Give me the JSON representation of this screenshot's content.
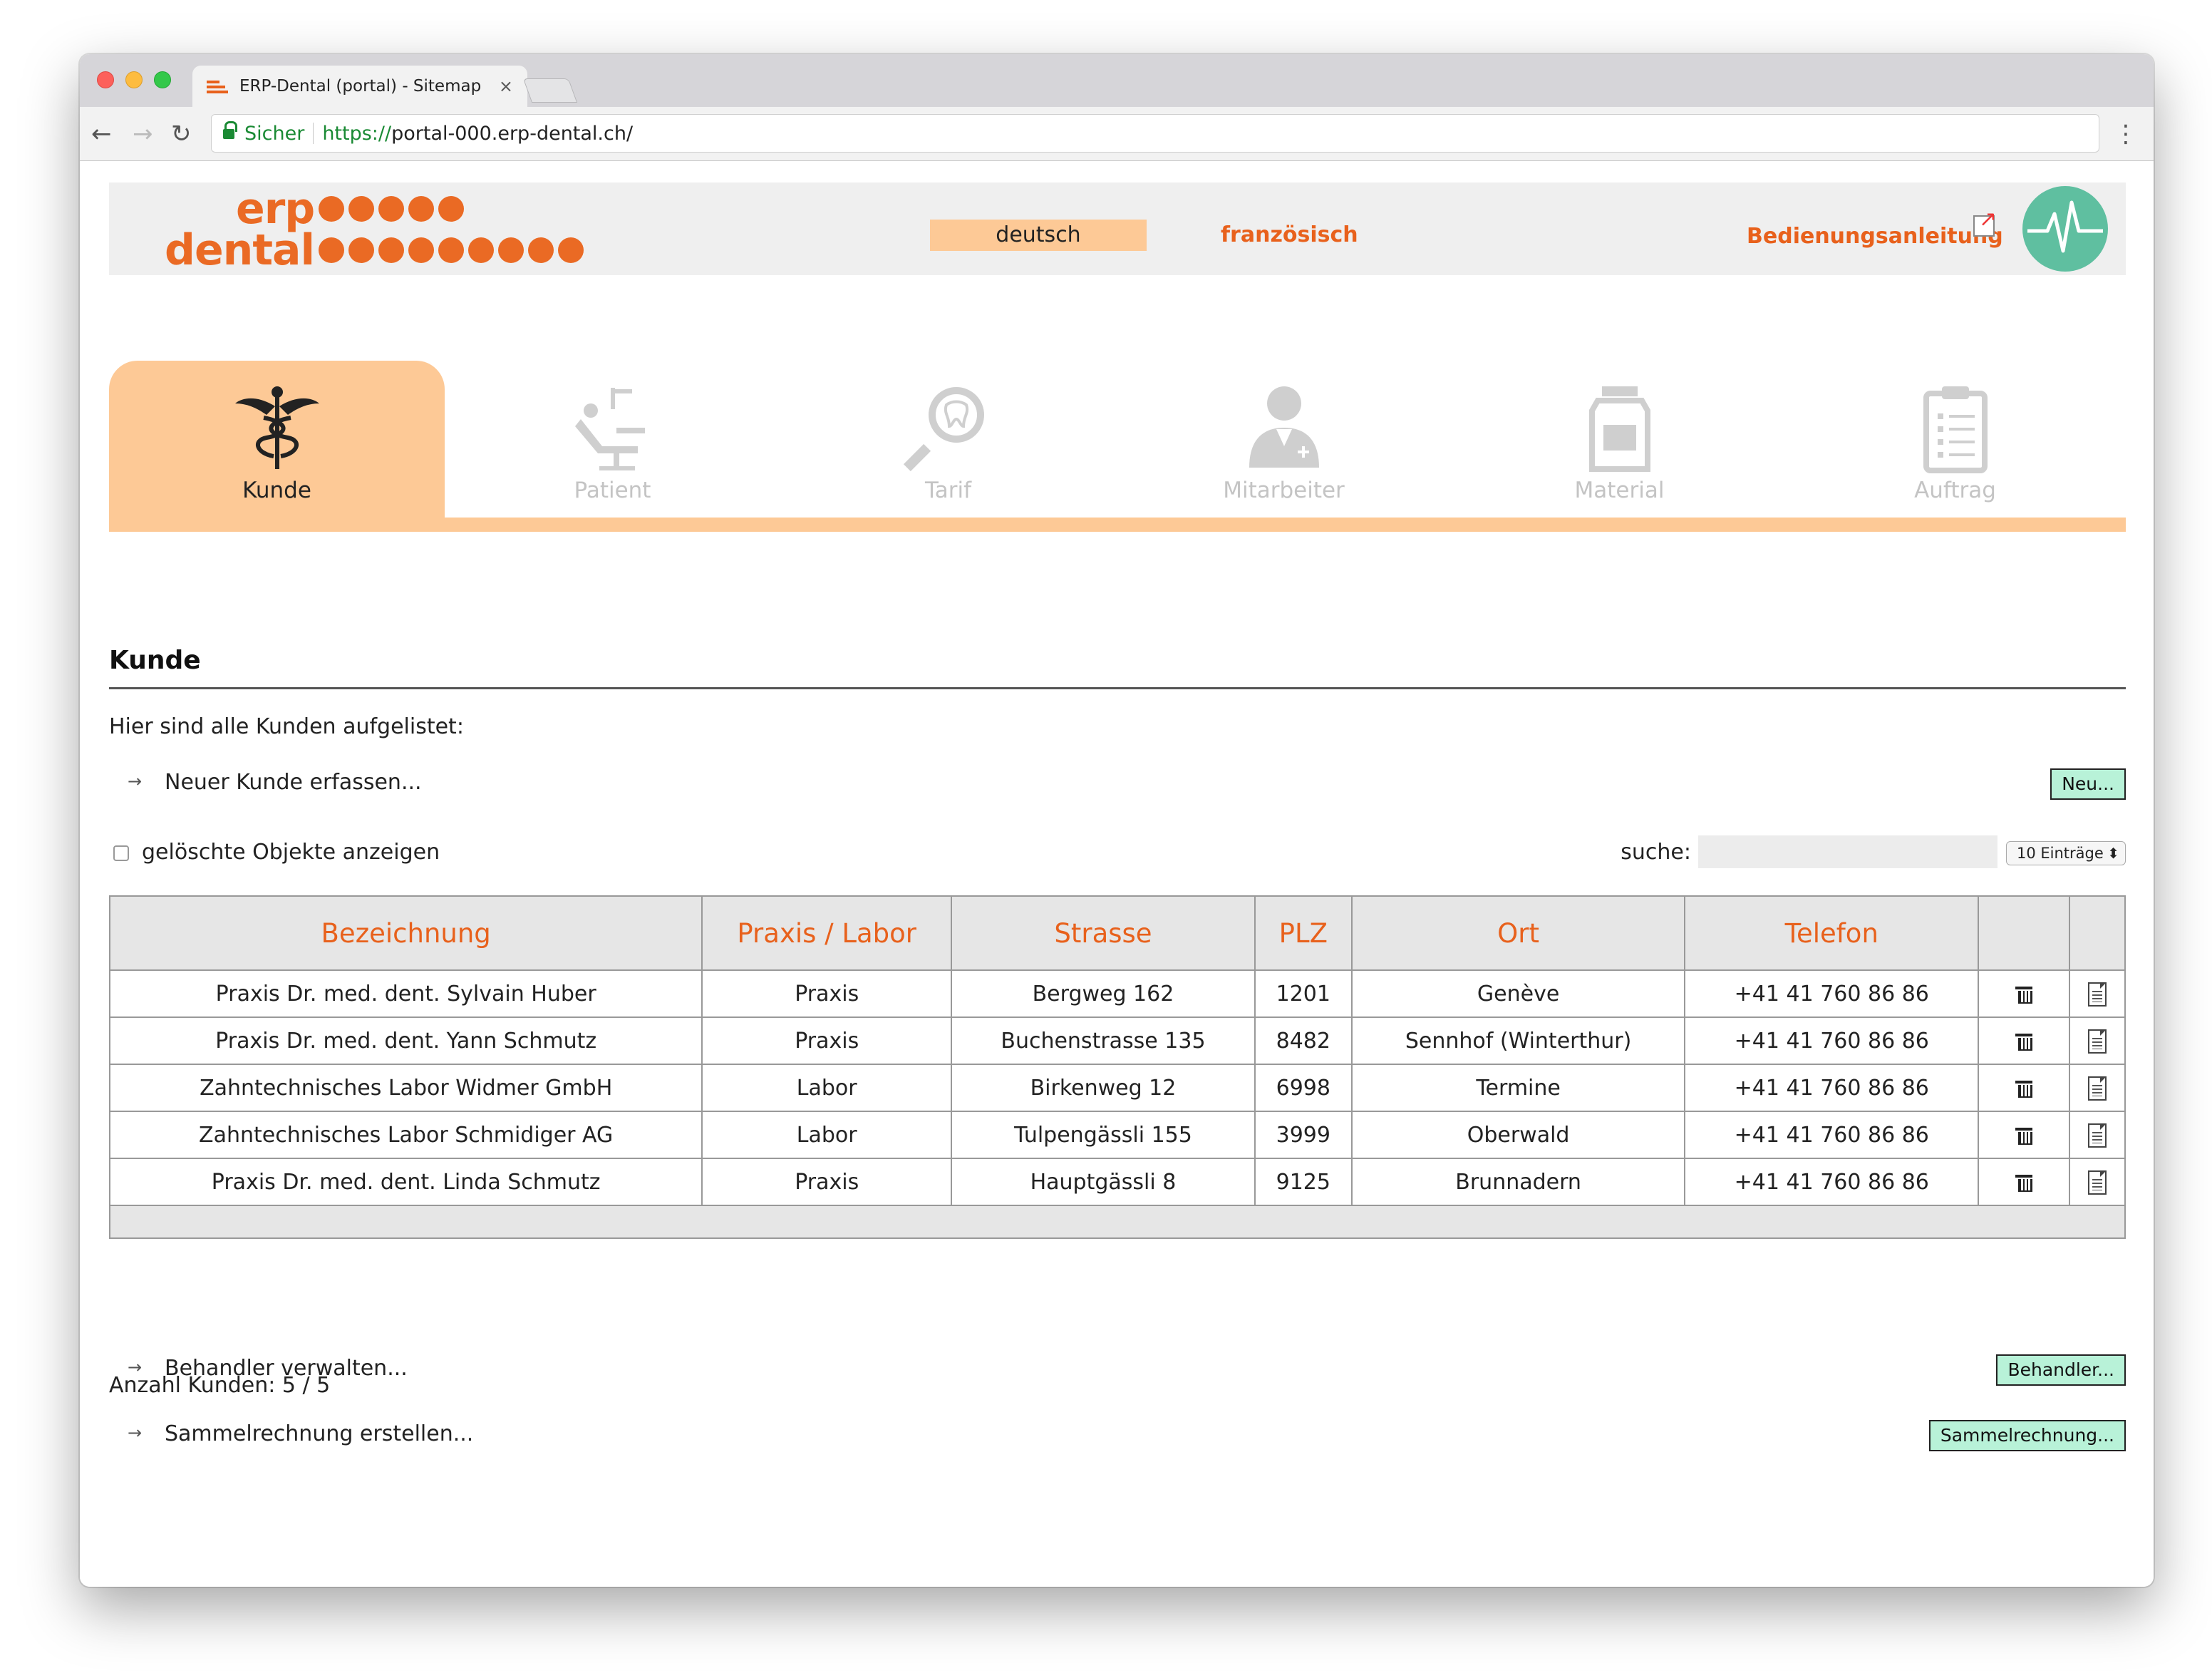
{
  "browser": {
    "tab_title": "ERP-Dental (portal) - Sitemap",
    "tab_close": "×",
    "secure_label": "Sicher",
    "url_scheme": "https://",
    "url_rest": "portal-000.erp-dental.ch/",
    "back": "←",
    "forward": "→",
    "reload": "↻",
    "menu": "⋮"
  },
  "header": {
    "logo_word1": "erp",
    "logo_word2": "dental",
    "lang_active": "deutsch",
    "lang_other": "französisch",
    "manual_link": "Bedienungsanleitung",
    "accent_color": "#e8611c",
    "highlight_color": "#fdc996"
  },
  "modules": [
    {
      "label": "Kunde",
      "icon": "caduceus-icon",
      "active": true
    },
    {
      "label": "Patient",
      "icon": "dental-chair-icon",
      "active": false
    },
    {
      "label": "Tarif",
      "icon": "tooth-magnifier-icon",
      "active": false
    },
    {
      "label": "Mitarbeiter",
      "icon": "doctor-icon",
      "active": false
    },
    {
      "label": "Material",
      "icon": "jar-icon",
      "active": false
    },
    {
      "label": "Auftrag",
      "icon": "clipboard-icon",
      "active": false
    }
  ],
  "section": {
    "title": "Kunde",
    "intro": "Hier sind alle Kunden aufgelistet:",
    "new_customer_text": "Neuer Kunde erfassen...",
    "new_button": "Neu...",
    "show_deleted_label": "gelöschte Objekte anzeigen",
    "search_label": "suche:",
    "search_value": "",
    "page_size": "10 Einträge"
  },
  "table": {
    "columns": [
      "Bezeichnung",
      "Praxis / Labor",
      "Strasse",
      "PLZ",
      "Ort",
      "Telefon",
      "",
      ""
    ],
    "rows": [
      [
        "Praxis Dr. med. dent. Sylvain Huber",
        "Praxis",
        "Bergweg 162",
        "1201",
        "Genève",
        "+41 41 760 86 86"
      ],
      [
        "Praxis Dr. med. dent. Yann Schmutz",
        "Praxis",
        "Buchenstrasse 135",
        "8482",
        "Sennhof (Winterthur)",
        "+41 41 760 86 86"
      ],
      [
        "Zahntechnisches Labor Widmer GmbH",
        "Labor",
        "Birkenweg 12",
        "6998",
        "Termine",
        "+41 41 760 86 86"
      ],
      [
        "Zahntechnisches Labor Schmidiger AG",
        "Labor",
        "Tulpengässli 155",
        "3999",
        "Oberwald",
        "+41 41 760 86 86"
      ],
      [
        "Praxis Dr. med. dent. Linda Schmutz",
        "Praxis",
        "Hauptgässli 8",
        "9125",
        "Brunnadern",
        "+41 41 760 86 86"
      ]
    ]
  },
  "footer": {
    "count_text": "Anzahl Kunden: 5 / 5",
    "behandler_text": "Behandler verwalten...",
    "behandler_button": "Behandler...",
    "sammel_text": "Sammelrechnung erstellen...",
    "sammel_button": "Sammelrechnung...",
    "arrow": "→"
  }
}
